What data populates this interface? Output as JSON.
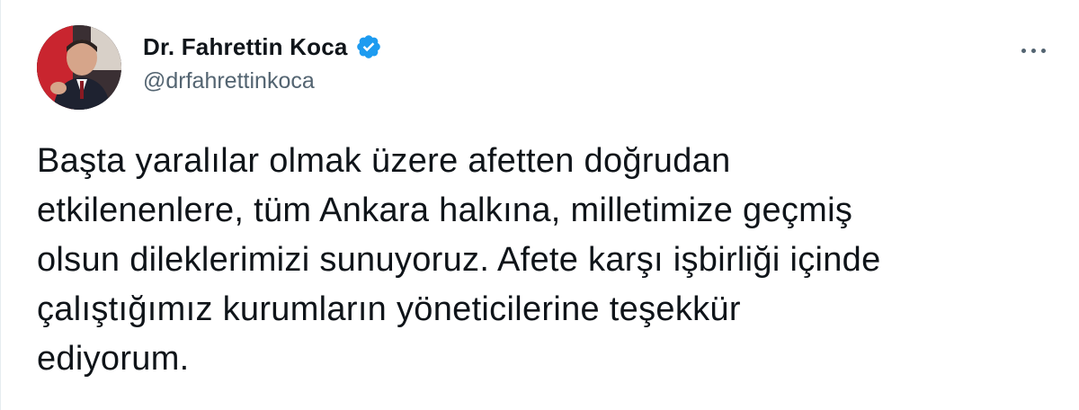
{
  "author": {
    "display_name": "Dr. Fahrettin Koca",
    "handle": "@drfahrettinkoca",
    "verified": true,
    "avatar_icon": "profile-photo"
  },
  "menu": {
    "more_icon": "more-horizontal-icon"
  },
  "tweet": {
    "lines": [
      "Başta yaralılar olmak üzere afetten doğrudan",
      "etkilenenlere, tüm Ankara halkına, milletimize geçmiş",
      "olsun dileklerimizi sunuyoruz. Afete karşı işbirliği içinde",
      "çalıştığımız kurumların yöneticilerine teşekkür",
      "ediyorum."
    ]
  },
  "colors": {
    "verified_blue": "#1d9bf0",
    "text_primary": "#0f1419",
    "text_secondary": "#536471"
  }
}
